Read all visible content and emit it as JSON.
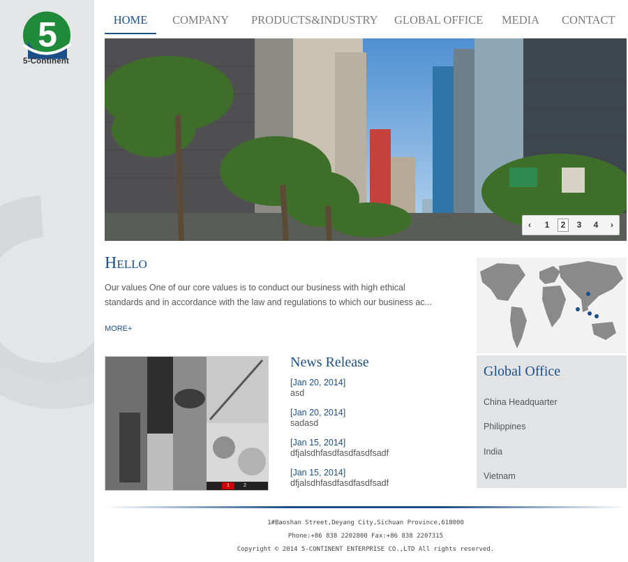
{
  "brand": {
    "name": "5-Continent",
    "logo_glyph": "5",
    "colors": {
      "green": "#1f8a3a",
      "blue": "#1b4f8a"
    }
  },
  "nav": {
    "items": [
      {
        "label": "HOME",
        "active": true
      },
      {
        "label": "COMPANY"
      },
      {
        "label": "PRODUCTS&INDUSTRY"
      },
      {
        "label": "GLOBAL OFFICE"
      },
      {
        "label": "MEDIA"
      },
      {
        "label": "CONTACT"
      }
    ]
  },
  "banner": {
    "pager": {
      "prev_icon": "chevron-left",
      "next_icon": "chevron-right",
      "pages": [
        "1",
        "2",
        "3",
        "4"
      ],
      "current": "2"
    }
  },
  "hello": {
    "title": "Hello",
    "text": "Our values One of our core values is to conduct our business with high ethical standards and in accordance with the law and regulations to which our business ac...",
    "more": "MORE+"
  },
  "collage": {
    "dots": [
      "1",
      "2"
    ],
    "current": "1"
  },
  "news": {
    "title": "News Release",
    "items": [
      {
        "date": "[Jan 20, 2014]",
        "headline": "asd"
      },
      {
        "date": "[Jan 20, 2014]",
        "headline": "sadasd"
      },
      {
        "date": "[Jan 15, 2014]",
        "headline": "dfjalsdhfasdfasdfasdfsadf"
      },
      {
        "date": "[Jan 15, 2014]",
        "headline": "dfjalsdhfasdfasdfasdfsadf"
      }
    ]
  },
  "global_office": {
    "title": "Global Office",
    "items": [
      "China Headquarter",
      "Philippines",
      "India",
      "Vietnam"
    ]
  },
  "footer": {
    "address": "1#Baoshan Street,Deyang City,Sichuan Province,618000",
    "phone": "Phone:+86 838 2202800 Fax:+86 838 2207315",
    "copyright": "Copyright © 2014 5-CONTINENT ENTERPRISE CO.,LTD All rights reserved."
  }
}
